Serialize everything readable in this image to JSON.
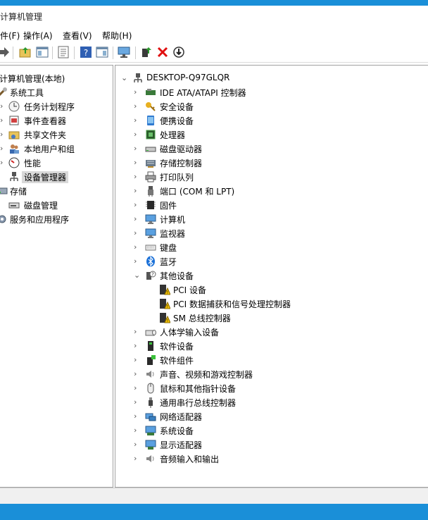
{
  "window": {
    "title": "计算机管理"
  },
  "menu": [
    {
      "label": "件(F)"
    },
    {
      "label": "操作(A)"
    },
    {
      "label": "查看(V)"
    },
    {
      "label": "帮助(H)"
    }
  ],
  "left_tree": {
    "root": "计算机管理(本地)",
    "system_tools": "系统工具",
    "task_scheduler": "任务计划程序",
    "event_viewer": "事件查看器",
    "shared_folders": "共享文件夹",
    "local_users": "本地用户和组",
    "performance": "性能",
    "device_manager": "设备管理器",
    "storage": "存储",
    "disk_management": "磁盘管理",
    "services_apps": "服务和应用程序"
  },
  "device_tree": {
    "computer": "DESKTOP-Q97GLQR",
    "categories": [
      {
        "label": "IDE ATA/ATAPI 控制器",
        "icon": "ide-controller-icon"
      },
      {
        "label": "安全设备",
        "icon": "key-security-icon"
      },
      {
        "label": "便携设备",
        "icon": "portable-device-icon"
      },
      {
        "label": "处理器",
        "icon": "processor-icon"
      },
      {
        "label": "磁盘驱动器",
        "icon": "disk-drive-icon"
      },
      {
        "label": "存储控制器",
        "icon": "storage-controller-icon"
      },
      {
        "label": "打印队列",
        "icon": "printer-icon"
      },
      {
        "label": "端口 (COM 和 LPT)",
        "icon": "port-icon"
      },
      {
        "label": "固件",
        "icon": "firmware-icon"
      },
      {
        "label": "计算机",
        "icon": "computer-icon"
      },
      {
        "label": "监视器",
        "icon": "monitor-icon"
      },
      {
        "label": "键盘",
        "icon": "keyboard-icon"
      },
      {
        "label": "蓝牙",
        "icon": "bluetooth-icon"
      },
      {
        "label": "其他设备",
        "icon": "other-devices-icon"
      },
      {
        "label": "人体学输入设备",
        "icon": "hid-icon"
      },
      {
        "label": "软件设备",
        "icon": "software-device-icon"
      },
      {
        "label": "软件组件",
        "icon": "software-component-icon"
      },
      {
        "label": "声音、视频和游戏控制器",
        "icon": "sound-icon"
      },
      {
        "label": "鼠标和其他指针设备",
        "icon": "mouse-icon"
      },
      {
        "label": "通用串行总线控制器",
        "icon": "usb-icon"
      },
      {
        "label": "网络适配器",
        "icon": "network-adapter-icon"
      },
      {
        "label": "系统设备",
        "icon": "system-device-icon"
      },
      {
        "label": "显示适配器",
        "icon": "display-adapter-icon"
      },
      {
        "label": "音频输入和输出",
        "icon": "audio-io-icon"
      }
    ],
    "other_devices_children": [
      {
        "label": "PCI 设备"
      },
      {
        "label": "PCI 数据捕获和信号处理控制器"
      },
      {
        "label": "SM 总线控制器"
      }
    ]
  },
  "colors": {
    "accent": "#1a8fd8",
    "selection": "#d9d9d9",
    "warning": "#f5c400"
  }
}
